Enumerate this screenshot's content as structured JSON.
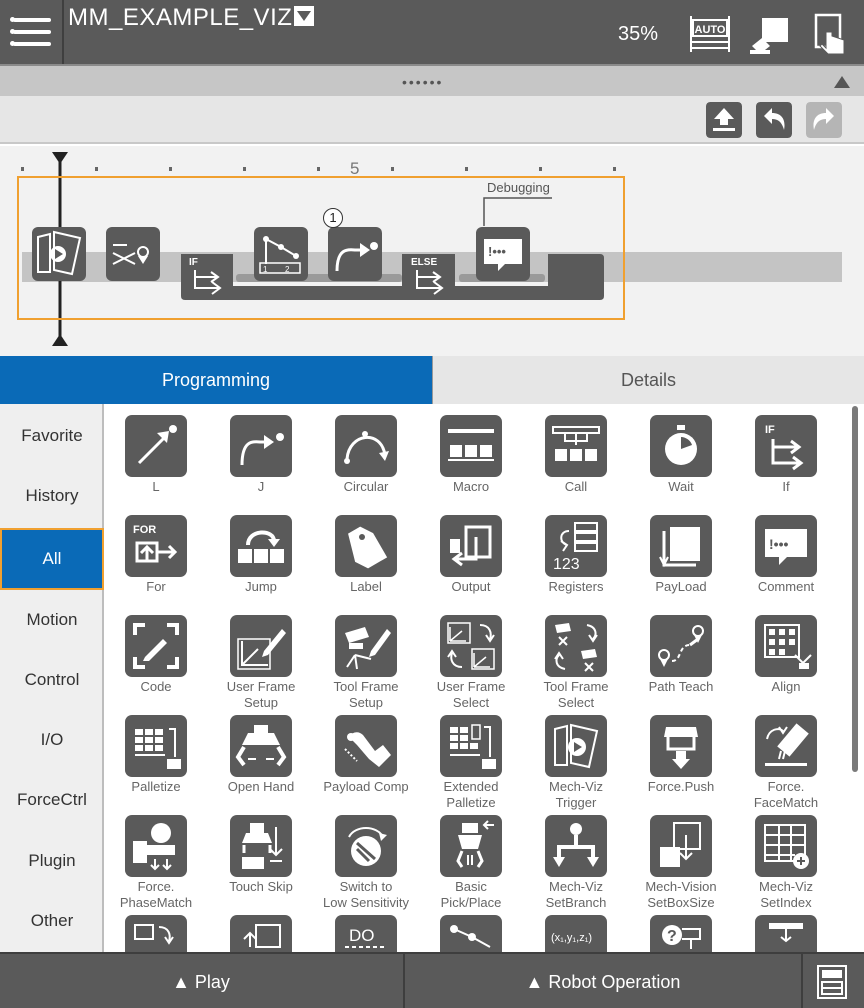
{
  "header": {
    "program_name": "MM_EXAMPLE_VIZ",
    "speed": "35%",
    "mode_badge": "AUTO",
    "icons": [
      "hamburger-icon",
      "auto-mode-icon",
      "teach-pendant-icon",
      "touch-screen-icon"
    ]
  },
  "toolbar": {
    "icons": [
      "upload-icon",
      "undo-icon",
      "redo-icon"
    ]
  },
  "flow": {
    "ruler_label": "5",
    "debug_label": "Debugging",
    "step_number": "1",
    "if_label": "IF",
    "else_label": "ELSE",
    "nodes": [
      "mech-viz-start-icon",
      "vision-icon",
      "if-icon",
      "register-branch-icon",
      "j-move-icon",
      "else-icon",
      "comment-icon"
    ]
  },
  "tabs": {
    "programming": "Programming",
    "details": "Details"
  },
  "sidebar": {
    "categories": [
      "Favorite",
      "History",
      "All",
      "Motion",
      "Control",
      "I/O",
      "ForceCtrl",
      "Plugin",
      "Other"
    ],
    "active": "All"
  },
  "palette": {
    "items": [
      {
        "line1": "L",
        "line2": "",
        "icon": "l-move-icon"
      },
      {
        "line1": "J",
        "line2": "",
        "icon": "j-move-icon"
      },
      {
        "line1": "Circular",
        "line2": "",
        "icon": "circular-icon"
      },
      {
        "line1": "Macro",
        "line2": "",
        "icon": "macro-icon"
      },
      {
        "line1": "Call",
        "line2": "",
        "icon": "call-icon"
      },
      {
        "line1": "Wait",
        "line2": "",
        "icon": "wait-icon"
      },
      {
        "line1": "If",
        "line2": "",
        "icon": "if-icon"
      },
      {
        "line1": "For",
        "line2": "",
        "icon": "for-icon"
      },
      {
        "line1": "Jump",
        "line2": "",
        "icon": "jump-icon"
      },
      {
        "line1": "Label",
        "line2": "",
        "icon": "label-icon"
      },
      {
        "line1": "Output",
        "line2": "",
        "icon": "output-icon"
      },
      {
        "line1": "Registers",
        "line2": "",
        "icon": "registers-icon"
      },
      {
        "line1": "PayLoad",
        "line2": "",
        "icon": "payload-icon"
      },
      {
        "line1": "Comment",
        "line2": "",
        "icon": "comment-icon"
      },
      {
        "line1": "Code",
        "line2": "",
        "icon": "code-icon"
      },
      {
        "line1": "User Frame",
        "line2": "Setup",
        "icon": "user-frame-setup-icon"
      },
      {
        "line1": "Tool Frame",
        "line2": "Setup",
        "icon": "tool-frame-setup-icon"
      },
      {
        "line1": "User Frame",
        "line2": "Select",
        "icon": "user-frame-select-icon"
      },
      {
        "line1": "Tool Frame",
        "line2": "Select",
        "icon": "tool-frame-select-icon"
      },
      {
        "line1": "Path Teach",
        "line2": "",
        "icon": "path-teach-icon"
      },
      {
        "line1": "Align",
        "line2": "",
        "icon": "align-icon"
      },
      {
        "line1": "Palletize",
        "line2": "",
        "icon": "palletize-icon"
      },
      {
        "line1": "Open Hand",
        "line2": "",
        "icon": "open-hand-icon"
      },
      {
        "line1": "Payload Comp",
        "line2": "",
        "icon": "payload-comp-icon"
      },
      {
        "line1": "Extended",
        "line2": "Palletize",
        "icon": "extended-palletize-icon"
      },
      {
        "line1": "Mech-Viz",
        "line2": "Trigger",
        "icon": "mech-viz-trigger-icon"
      },
      {
        "line1": "Force.Push",
        "line2": "",
        "icon": "force-push-icon"
      },
      {
        "line1": "Force.",
        "line2": "FaceMatch",
        "icon": "force-facematch-icon"
      },
      {
        "line1": "Force.",
        "line2": "PhaseMatch",
        "icon": "force-phasematch-icon"
      },
      {
        "line1": "Touch Skip",
        "line2": "",
        "icon": "touch-skip-icon"
      },
      {
        "line1": "Switch to",
        "line2": "Low Sensitivity",
        "icon": "switch-low-sensitivity-icon"
      },
      {
        "line1": "Basic",
        "line2": "Pick/Place",
        "icon": "basic-pick-place-icon"
      },
      {
        "line1": "Mech-Viz",
        "line2": "SetBranch",
        "icon": "mech-viz-setbranch-icon"
      },
      {
        "line1": "Mech-Vision",
        "line2": "SetBoxSize",
        "icon": "mech-vision-setboxsize-icon"
      },
      {
        "line1": "Mech-Viz",
        "line2": "SetIndex",
        "icon": "mech-viz-setindex-icon"
      },
      {
        "line1": "",
        "line2": "",
        "icon": "extra-1-icon"
      },
      {
        "line1": "",
        "line2": "",
        "icon": "extra-2-icon"
      },
      {
        "line1": "",
        "line2": "",
        "icon": "do-icon"
      },
      {
        "line1": "",
        "line2": "",
        "icon": "path-icon"
      },
      {
        "line1": "",
        "line2": "",
        "icon": "xyz-position-icon"
      },
      {
        "line1": "",
        "line2": "",
        "icon": "question-icon"
      },
      {
        "line1": "",
        "line2": "",
        "icon": "extra-3-icon"
      }
    ],
    "partial_icon_text": {
      "do": "DO",
      "xyz": "(x₁,y₁,z₁)",
      "for": "FOR",
      "registers": "123",
      "if": "IF"
    }
  },
  "bottom": {
    "play": "▲ Play",
    "robot_operation": "▲ Robot Operation"
  },
  "colors": {
    "header_bg": "#5a5a5a",
    "accent_blue": "#0a6ab7",
    "highlight_orange": "#f0a030",
    "icon_tile": "#5a5a5a"
  }
}
